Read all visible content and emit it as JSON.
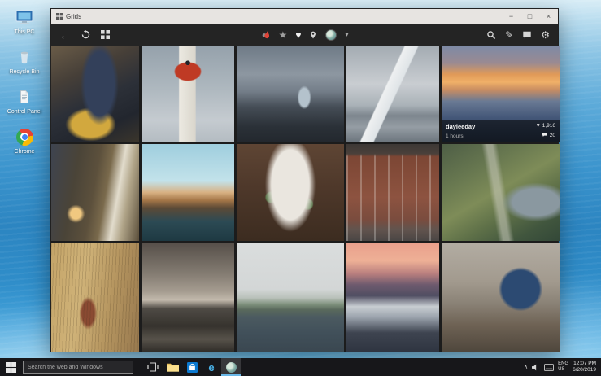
{
  "window": {
    "title": "Grids"
  },
  "window_controls": {
    "minimize": "−",
    "maximize": "□",
    "close": "×"
  },
  "glyphs": {
    "back": "←",
    "star": "★",
    "heart": "♥",
    "caret_down": "▾",
    "pencil": "✎",
    "gear": "⚙",
    "tray_caret": "∧",
    "overlay_heart": "♥"
  },
  "post": {
    "username": "dayleeday",
    "time_ago": "1 hours",
    "likes": "1,916",
    "comments": "20"
  },
  "grid": {
    "photos": [
      {
        "desc": "top-down view of legs in dark jeans and sneakers on cliff edge with yellow jacket",
        "bg": "radial-gradient(ellipse 30px 65px at 55% 40%, #33405a 60%, rgba(51,64,90,0) 78%), radial-gradient(ellipse 42px 28px at 45% 82%, #d2a83e 55%, rgba(210,168,62,0) 74%), linear-gradient(155deg, #6a5c48 0%, #463f38 30%, #2c3038 55%, #22262e 78%, #3a352c 100%)"
      },
      {
        "desc": "white lighthouse with red top against grey cloudy sky",
        "bg": "radial-gradient(circle 3px at 50% 18%, #20242a 90%, rgba(32,36,42,0) 100%), radial-gradient(ellipse 17px 12px at 50% 27%, #bf3a24 90%, rgba(191,58,36,0) 100%), linear-gradient(90deg, rgba(236,233,225,0) 40%, #ece9e1 41%, #d9d6cc 58%, rgba(217,214,204,0) 59%), linear-gradient(180deg, #95a1ab 0%, #aeb8bf 45%, #c5cbd0 78%, #b4bcc2 100%)"
      },
      {
        "desc": "rocky coastline under stormy sky with woman in pale dress on the rocks",
        "bg": "radial-gradient(ellipse 10px 17px at 63% 54%, #b4c2cc 65%, rgba(180,194,204,0) 85%), linear-gradient(180deg, #6e7a86 0%, #8d97a1 30%, #737d88 48%, #454d56 64%, #2b3138 84%, #23282e 100%)"
      },
      {
        "desc": "white sailboat on grey water under overcast sky",
        "bg": "linear-gradient(115deg, rgba(238,240,241,0) 42%, #eef0f1 43%, #dfe4e7 52%, rgba(223,228,231,0) 53%), linear-gradient(180deg, #a3abb2 0%, #c9cdd1 40%, #aab2b8 62%, #7d868e 73%, #959da4 85%, #6d767e 100%)"
      },
      {
        "desc": "harbour with moored boats at orange sunset",
        "bg": "linear-gradient(180deg, #7c8aa6 0%, #9a8a92 18%, #e09a58 30%, #f0b068 38%, #c98d62 46%, #6a7a94 58%, #46597a 74%, #2f4260 90%, #263750 100%)"
      },
      {
        "desc": "woman sitting by bright window in wood-panelled room with warm lamp",
        "bg": "radial-gradient(circle 14px at 28% 72%, #f0c880 45%, rgba(240,200,128,0) 80%), linear-gradient(100deg, #3e4450 0%, #4a4438 28%, #5c503c 48%, #7a6a4c 60%, #e2dccc 72%, #b0a488 82%, #5a4e3a 100%)"
      },
      {
        "desc": "Stockholm waterfront skyline at golden hour",
        "bg": "linear-gradient(180deg, #9fcede 0%, #c2e2ea 38%, #d8b183 50%, #a57748 58%, #5c4a36 66%, #2c4a54 80%, #1e3942 100%)"
      },
      {
        "desc": "white wedding dress laid flat on dark wooden floor with green leaves",
        "bg": "radial-gradient(ellipse 42px 78px at 50% 42%, #eae6df 55%, rgba(234,230,223,0) 74%), radial-gradient(circle 8px at 32% 55%, #5d7a4e 75%, rgba(93,122,78,0) 95%), radial-gradient(circle 8px at 66% 62%, #5d7a4e 75%, rgba(93,122,78,0) 95%), linear-gradient(180deg, #5e4534 0%, #4e382a 45%, #3c2c20 100%)"
      },
      {
        "desc": "red brick building facade with rows of windows and cyclists below",
        "bg": "linear-gradient(180deg, #3c3835 0%, #4a403a 10%, rgba(0,0,0,0) 13%), repeating-linear-gradient(90deg, rgba(240,240,235,0.28) 0 2px, rgba(0,0,0,0) 2px 17px), linear-gradient(180deg, #7c4634 12%, #8d5340 55%, #7a4c3e 78%, #62544e 88%, #4a4644 100%)"
      },
      {
        "desc": "green mountainside with small village by fjord and winding gravel road",
        "bg": "radial-gradient(ellipse 52px 30px at 80% 60%, #8a98a0 55%, rgba(138,152,160,0) 80%), linear-gradient(80deg, rgba(205,205,192,0) 42%, rgba(205,205,192,0.55) 46%, rgba(205,205,192,0.55) 50%, rgba(205,205,192,0) 54%), linear-gradient(150deg, #4e5e46 0%, #687850 28%, #7e8c58 48%, #5e7048 66%, #41563e 84%, #334838 100%)"
      },
      {
        "desc": "red-haired woman standing among tall golden reeds",
        "bg": "repeating-linear-gradient(93deg, rgba(60,45,25,0.18) 0 1px, rgba(0,0,0,0) 1px 4px), radial-gradient(ellipse 14px 26px at 42% 64%, #8a4a32 55%, rgba(138,74,50,0) 78%), linear-gradient(100deg, #c4a468 0%, #cfb278 35%, #b69660 65%, #97784e 100%)"
      },
      {
        "desc": "person walking through old stone alley reflected in wet pavement",
        "bg": "linear-gradient(180deg, #57504a 0%, #847c72 28%, #a59c90 44%, #c2b9ac 52%, #4e4a44 60%, #36332e 76%, #57524a 88%, #2e2b27 100%)"
      },
      {
        "desc": "misty fjord with green headland under low fog and wooden dock",
        "bg": "linear-gradient(180deg, #dadddd 0%, #d3d6d6 42%, #b9c1ba 50%, #7e917c 56%, #59695c 61%, #4b5a60 68%, #41505a 82%, #3a4750 100%)"
      },
      {
        "desc": "small boats moored in harbour under pink sunset sky",
        "bg": "linear-gradient(180deg, #e9a08c 0%, #eeb096 16%, #b87e7e 28%, #6e5a6e 38%, #504e62 48%, #c8cdd2 58%, #9aa2ac 68%, #3e4450 82%, #2e3440 100%)"
      },
      {
        "desc": "woman holding dark blue umbrella in old town street",
        "bg": "radial-gradient(circle 27px at 67% 42%, #2c4a72 85%, rgba(44,74,114,0) 100%), linear-gradient(180deg, #b2aca2 0%, #a29a8e 35%, #8a8276 55%, #6e6254 75%, #4e463c 100%)"
      }
    ]
  },
  "desktop": {
    "icons": [
      {
        "label": "This PC"
      },
      {
        "label": "Recycle Bin"
      },
      {
        "label": "Control Panel"
      },
      {
        "label": "Chrome"
      }
    ]
  },
  "taskbar": {
    "search_placeholder": "Search the web and Windows",
    "tray": {
      "lang_top": "ENG",
      "lang_bottom": "US",
      "time": "12:07 PM",
      "date": "6/20/2019"
    }
  }
}
